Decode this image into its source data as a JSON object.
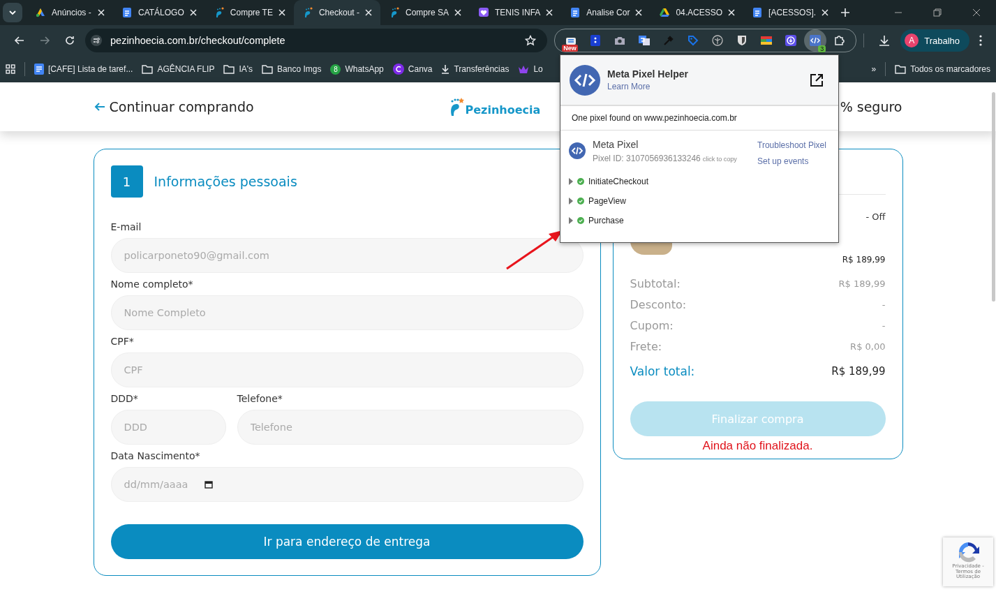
{
  "browser": {
    "tabs": [
      {
        "label": "Anúncios -",
        "kind": "ads",
        "selected": false
      },
      {
        "label": "CATÁLOGO",
        "kind": "doc",
        "selected": false
      },
      {
        "label": "Compre TE",
        "kind": "foot",
        "selected": false
      },
      {
        "label": "Checkout -",
        "kind": "foot",
        "selected": true
      },
      {
        "label": "Compre SA",
        "kind": "foot",
        "selected": false
      },
      {
        "label": "TENIS INFA",
        "kind": "heart",
        "selected": false
      },
      {
        "label": "Analise Cor",
        "kind": "doc",
        "selected": false
      },
      {
        "label": "04.ACESSO",
        "kind": "drive",
        "selected": false
      },
      {
        "label": "[ACESSOS].",
        "kind": "doc",
        "selected": false
      }
    ],
    "address": "pezinhoecia.com.br/checkout/complete",
    "new_badge": "New",
    "pixel_badge": "3",
    "profile": {
      "initial": "A",
      "name": "Trabalho"
    },
    "bookmarks": [
      {
        "label": "[CAFE] Lista de taref...",
        "kind": "doc"
      },
      {
        "label": "AGÊNCIA FLIP",
        "kind": "folder"
      },
      {
        "label": "IA's",
        "kind": "folder"
      },
      {
        "label": "Banco Imgs",
        "kind": "folder"
      },
      {
        "label": "WhatsApp",
        "kind": "whatsapp",
        "badge": "8"
      },
      {
        "label": "Canva",
        "kind": "canva"
      },
      {
        "label": "Transferências",
        "kind": "download"
      },
      {
        "label": "Lo",
        "kind": "crown"
      }
    ],
    "bookmarks_overflow": "»",
    "all_bookmarks": "Todos os marcadores"
  },
  "header": {
    "back_link": "Continuar comprando",
    "logo": "Pezinhoecia",
    "secure": "% seguro"
  },
  "personal_info": {
    "step": "1",
    "title": "Informações pessoais",
    "rows": [
      {
        "fields": [
          {
            "label": "E-mail",
            "value": "policarponeto90@gmail.com",
            "kind": "text"
          }
        ]
      },
      {
        "fields": [
          {
            "label": "Nome completo*",
            "placeholder": "Nome Completo",
            "kind": "text"
          }
        ]
      },
      {
        "fields": [
          {
            "label": "CPF*",
            "placeholder": "CPF",
            "kind": "text"
          }
        ]
      },
      {
        "fields": [
          {
            "label": "DDD*",
            "placeholder": "DDD",
            "kind": "text"
          },
          {
            "label": "Telefone*",
            "placeholder": "Telefone",
            "kind": "text"
          }
        ]
      },
      {
        "fields": [
          {
            "label": "Data Nascimento*",
            "placeholder": "dd/mm/aaaa",
            "kind": "date"
          }
        ]
      }
    ],
    "submit": "Ir para endereço de entrega"
  },
  "summary": {
    "product": {
      "title": "- Off",
      "price": "R$ 189,99"
    },
    "lines": [
      {
        "label": "Subtotal:",
        "value": "R$ 189,99"
      },
      {
        "label": "Desconto:",
        "value": "-"
      },
      {
        "label": "Cupom:",
        "value": "-"
      },
      {
        "label": "Frete:",
        "value": "R$ 0,00"
      }
    ],
    "total": {
      "label": "Valor total:",
      "value": "R$ 189,99"
    },
    "button": {
      "label": "Finalizar compra",
      "disabled": true
    },
    "status": "Ainda não finalizada."
  },
  "pixel_helper": {
    "title": "Meta Pixel Helper",
    "learn_more": "Learn More",
    "found": "One pixel found on www.pezinhoecia.com.br",
    "pixel": {
      "name": "Meta Pixel",
      "id_label": "Pixel ID: 3107056936133246",
      "copy": "click to copy",
      "links": [
        "Troubleshoot Pixel",
        "Set up events"
      ],
      "events": [
        {
          "name": "InitiateCheckout",
          "expanded": false
        },
        {
          "name": "PageView",
          "expanded": false
        },
        {
          "name": "Purchase",
          "expanded": false
        }
      ]
    }
  },
  "recaptcha": {
    "terms": "Privacidade - Termos de Utilização"
  }
}
